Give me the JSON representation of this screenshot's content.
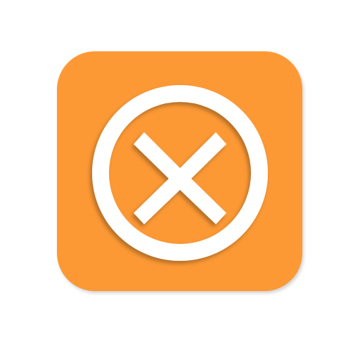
{
  "icon": {
    "name": "close-circle-icon",
    "tile_color": "#FD9935",
    "glyph_color": "#FFFFFF",
    "shadow_color": "#5A3A1A"
  }
}
